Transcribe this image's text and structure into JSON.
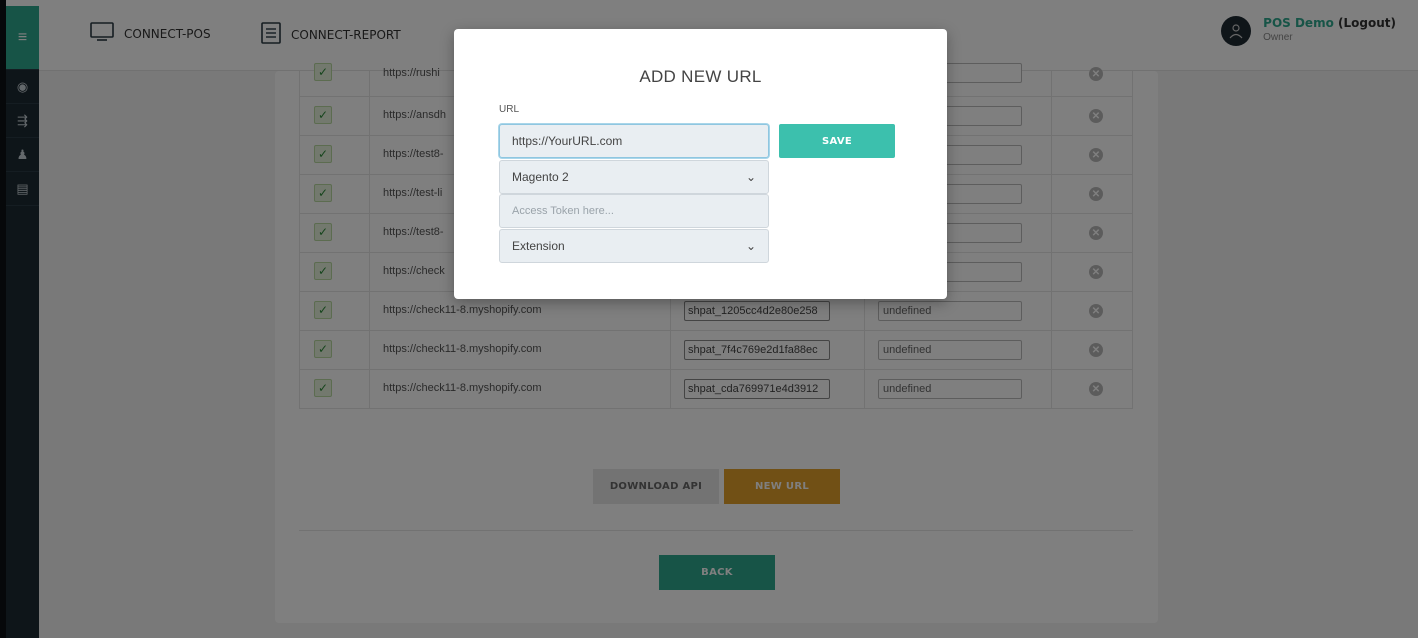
{
  "nav": {
    "items": [
      {
        "label": "CONNECT-POS",
        "icon": "monitor-icon"
      },
      {
        "label": "CONNECT-REPORT",
        "icon": "document-icon"
      }
    ]
  },
  "user": {
    "name": "POS Demo",
    "logout_label": "(Logout)",
    "role": "Owner"
  },
  "sidebar": {
    "items": [
      {
        "icon": "menu-icon",
        "glyph": "≡"
      },
      {
        "icon": "layers-icon",
        "glyph": "◉"
      },
      {
        "icon": "sliders-icon",
        "glyph": "⇶"
      },
      {
        "icon": "user-icon",
        "glyph": "♟"
      },
      {
        "icon": "database-icon",
        "glyph": "▤"
      }
    ]
  },
  "table": {
    "rows": [
      {
        "url": "https://rushi",
        "token": "",
        "status": ""
      },
      {
        "url": "https://ansdh",
        "token": "",
        "status": ""
      },
      {
        "url": "https://test8-",
        "token": "",
        "status": ""
      },
      {
        "url": "https://test-li",
        "token": "",
        "status": ""
      },
      {
        "url": "https://test8-",
        "token": "",
        "status": ""
      },
      {
        "url": "https://check",
        "token": "",
        "status": ""
      },
      {
        "url": "https://check11-8.myshopify.com",
        "token": "shpat_1205cc4d2e80e258",
        "status": "undefined"
      },
      {
        "url": "https://check11-8.myshopify.com",
        "token": "shpat_7f4c769e2d1fa88ec",
        "status": "undefined"
      },
      {
        "url": "https://check11-8.myshopify.com",
        "token": "shpat_cda769971e4d3912",
        "status": "undefined"
      }
    ]
  },
  "buttons": {
    "download_api": "DOWNLOAD API",
    "new_url": "NEW URL",
    "back": "BACK"
  },
  "modal": {
    "title": "ADD NEW URL",
    "url_label": "URL",
    "url_value": "https://YourURL.com",
    "platform_value": "Magento 2",
    "token_placeholder": "Access Token here...",
    "type_value": "Extension",
    "save_label": "SAVE"
  },
  "colors": {
    "accent": "#2fa88e",
    "save": "#3cc0ad",
    "new_url": "#e2a02a",
    "sidebar": "#1d2a33"
  }
}
